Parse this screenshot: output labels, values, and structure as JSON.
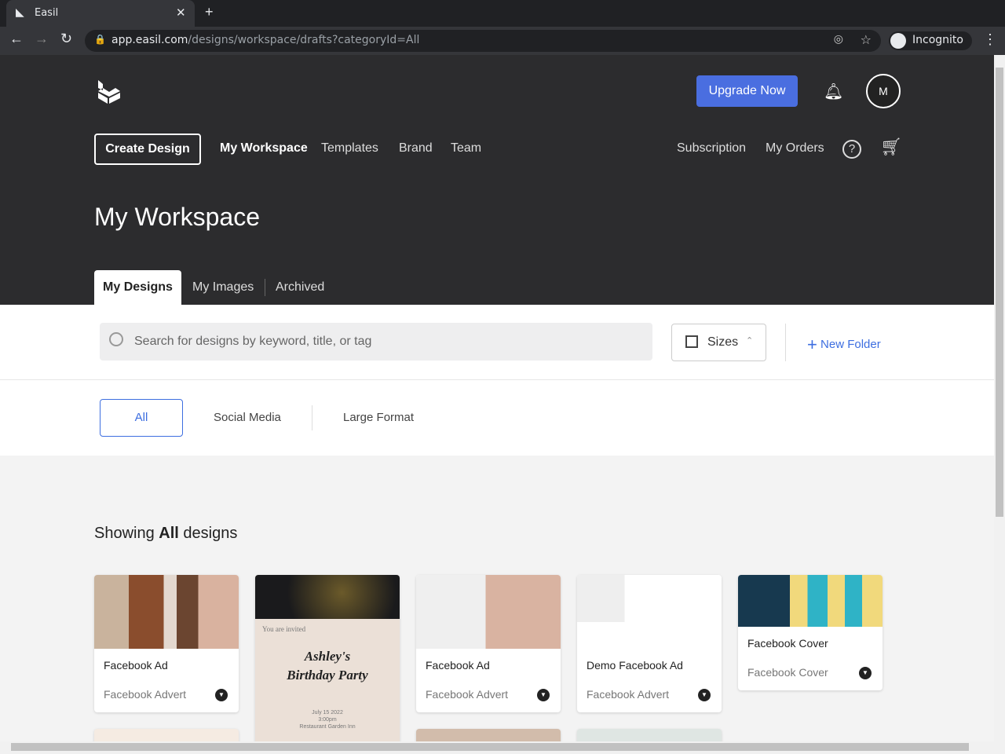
{
  "browser": {
    "tab_title": "Easil",
    "url_host": "app.easil.com",
    "url_path": "/designs/workspace/drafts?categoryId=All",
    "profile": "Incognito"
  },
  "header": {
    "upgrade": "Upgrade Now",
    "avatar": "M",
    "create": "Create Design",
    "nav": [
      "My Workspace",
      "Templates",
      "Brand",
      "Team"
    ],
    "right_nav": [
      "Subscription",
      "My Orders"
    ],
    "title": "My Workspace",
    "tabs": [
      "My Designs",
      "My Images",
      "Archived"
    ]
  },
  "toolbar": {
    "search_placeholder": "Search for designs by keyword, title, or tag",
    "sizes": "Sizes",
    "new_folder": "New Folder"
  },
  "filters": [
    "All",
    "Social Media",
    "Large Format"
  ],
  "showing": {
    "prefix": "Showing",
    "bold": "All",
    "suffix": "designs"
  },
  "cards": [
    {
      "title": "Facebook Ad",
      "subtitle": "Facebook Advert"
    },
    {
      "invite": "You are invited",
      "name1": "Ashley's",
      "name2": "Birthday Party",
      "date": "July 15 2022",
      "time": "3:00pm",
      "venue": "Restaurant Garden Inn"
    },
    {
      "title": "Facebook Ad",
      "subtitle": "Facebook Advert"
    },
    {
      "title": "Demo Facebook Ad",
      "subtitle": "Facebook Advert"
    },
    {
      "title": "Facebook Cover",
      "subtitle": "Facebook Cover"
    }
  ],
  "colors": {
    "accent": "#3d6ee0",
    "header_bg": "#2c2c2e",
    "upgrade": "#4a6ee0"
  }
}
